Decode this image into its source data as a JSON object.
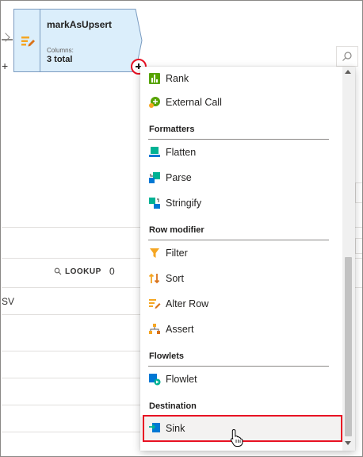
{
  "node": {
    "title": "markAsUpsert",
    "columns_label": "Columns:",
    "columns_value": "3 total"
  },
  "grid": {
    "lookup_label": "LOOKUP",
    "lookup_count": "0",
    "first_cell": "SV"
  },
  "menu": {
    "items_top": [
      {
        "label": "Rank",
        "icon": "rank-icon"
      },
      {
        "label": "External Call",
        "icon": "external-call-icon"
      }
    ],
    "sections": {
      "formatters": "Formatters",
      "row_modifier": "Row modifier",
      "flowlets": "Flowlets",
      "destination": "Destination"
    },
    "formatters": [
      {
        "label": "Flatten",
        "icon": "flatten-icon"
      },
      {
        "label": "Parse",
        "icon": "parse-icon"
      },
      {
        "label": "Stringify",
        "icon": "stringify-icon"
      }
    ],
    "row_modifier": [
      {
        "label": "Filter",
        "icon": "filter-icon"
      },
      {
        "label": "Sort",
        "icon": "sort-icon"
      },
      {
        "label": "Alter Row",
        "icon": "alter-row-icon"
      },
      {
        "label": "Assert",
        "icon": "assert-icon"
      }
    ],
    "flowlets": [
      {
        "label": "Flowlet",
        "icon": "flowlet-icon"
      }
    ],
    "destination": [
      {
        "label": "Sink",
        "icon": "sink-icon"
      }
    ]
  },
  "colors": {
    "highlight": "#e81123",
    "node_fill": "#dbeefb",
    "node_border": "#7a9bc0"
  }
}
